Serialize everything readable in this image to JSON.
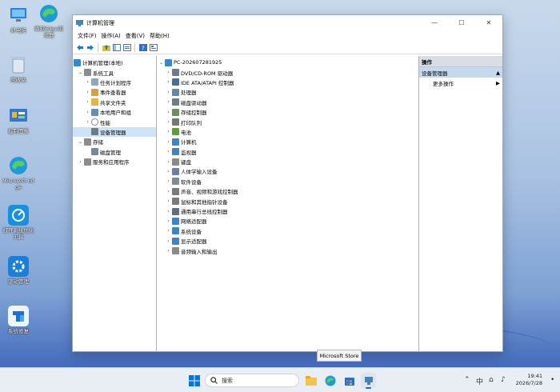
{
  "desktop": {
    "icons": [
      {
        "label": "此电脑"
      },
      {
        "label": "微软Edge浏览器"
      },
      {
        "label": "回收站"
      },
      {
        "label": "控制面板"
      },
      {
        "label": "Microsoft Edge"
      },
      {
        "label": "打开系统优化工具"
      },
      {
        "label": "驱动管理"
      },
      {
        "label": "系统修复"
      }
    ]
  },
  "window": {
    "title": "计算机管理",
    "menu": [
      "文件(F)",
      "操作(A)",
      "查看(V)",
      "帮助(H)"
    ],
    "controls": {
      "minimize": "—",
      "maximize": "☐",
      "close": "✕"
    }
  },
  "left_tree": {
    "root": "计算机管理(本地)",
    "items": [
      {
        "label": "系统工具",
        "level": 1,
        "toggle": "⌄"
      },
      {
        "label": "任务计划程序",
        "level": 2,
        "toggle": "›"
      },
      {
        "label": "事件查看器",
        "level": 2,
        "toggle": "›"
      },
      {
        "label": "共享文件夹",
        "level": 2,
        "toggle": "›"
      },
      {
        "label": "本地用户和组",
        "level": 2,
        "toggle": "›"
      },
      {
        "label": "性能",
        "level": 2,
        "toggle": "›"
      },
      {
        "label": "设备管理器",
        "level": 2,
        "toggle": "",
        "selected": true
      },
      {
        "label": "存储",
        "level": 1,
        "toggle": "⌄"
      },
      {
        "label": "磁盘管理",
        "level": 2,
        "toggle": ""
      },
      {
        "label": "服务和应用程序",
        "level": 1,
        "toggle": "›"
      }
    ]
  },
  "device_tree": {
    "root": "PC-202607281925",
    "items": [
      {
        "label": "DVD/CD-ROM 驱动器",
        "color": "#6f7b86"
      },
      {
        "label": "IDE ATA/ATAPI 控制器",
        "color": "#4b6e94"
      },
      {
        "label": "处理器",
        "color": "#5f8aa8"
      },
      {
        "label": "磁盘驱动器",
        "color": "#6f7b86"
      },
      {
        "label": "存储控制器",
        "color": "#6e8f5c"
      },
      {
        "label": "打印队列",
        "color": "#767676"
      },
      {
        "label": "电池",
        "color": "#5b9f3e"
      },
      {
        "label": "计算机",
        "color": "#3a86c8"
      },
      {
        "label": "监视器",
        "color": "#3a86c8"
      },
      {
        "label": "键盘",
        "color": "#8a8a8a"
      },
      {
        "label": "人体学输入设备",
        "color": "#6e7fa0"
      },
      {
        "label": "软件设备",
        "color": "#7f8a96"
      },
      {
        "label": "声音、视频和游戏控制器",
        "color": "#7a7a7a"
      },
      {
        "label": "鼠标和其他指针设备",
        "color": "#7a7a7a"
      },
      {
        "label": "通用串行总线控制器",
        "color": "#5d6f80"
      },
      {
        "label": "网络适配器",
        "color": "#3a86c8"
      },
      {
        "label": "系统设备",
        "color": "#3a86c8"
      },
      {
        "label": "显示适配器",
        "color": "#3a86c8"
      },
      {
        "label": "音频输入和输出",
        "color": "#8a8a8a"
      }
    ]
  },
  "actions": {
    "header": "操作",
    "section": "设备管理器",
    "more": "更多操作"
  },
  "tooltip": "Microsoft Store",
  "taskbar": {
    "search_placeholder": "搜索",
    "time": "19:41",
    "date": "2026/7/28",
    "ime": "中"
  },
  "colors": {
    "accent": "#0078d4",
    "selection": "#cfe3f7",
    "actions_section_bg": "#c6d8ee"
  }
}
